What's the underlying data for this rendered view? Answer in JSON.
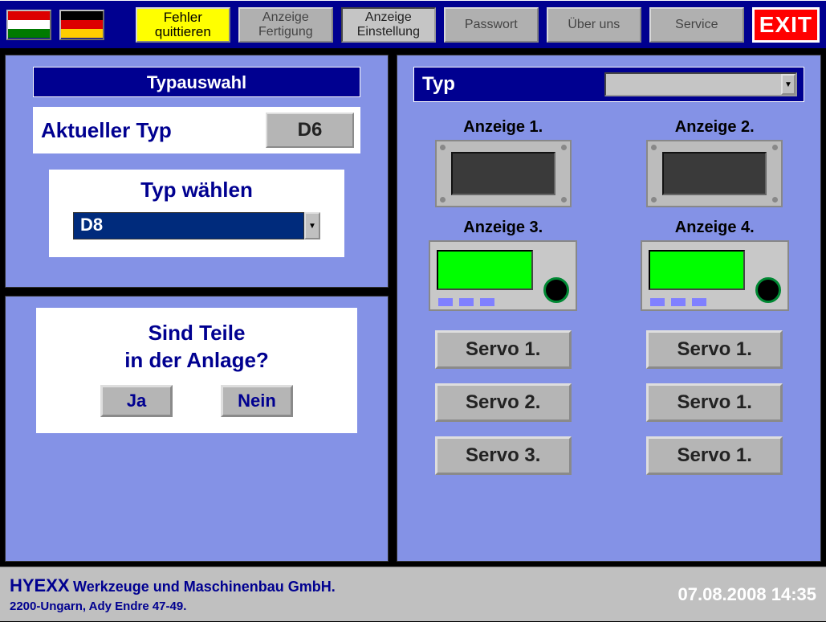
{
  "topbar": {
    "fehler_label": "Fehler\nquittieren",
    "anzeige_fertigung": "Anzeige\nFertigung",
    "anzeige_einstellung": "Anzeige\nEinstellung",
    "passwort": "Passwort",
    "ueber_uns": "Über uns",
    "service": "Service",
    "exit": "EXIT"
  },
  "left": {
    "header": "Typauswahl",
    "current_label": "Aktueller Typ",
    "current_value": "D6",
    "select_title": "Typ wählen",
    "select_value": "D8",
    "question_line1": "Sind Teile",
    "question_line2": "in der Anlage?",
    "yes": "Ja",
    "no": "Nein"
  },
  "right": {
    "typ_label": "Typ",
    "typ_value": "",
    "anzeige": [
      "Anzeige 1.",
      "Anzeige 2.",
      "Anzeige 3.",
      "Anzeige 4."
    ],
    "servos": [
      "Servo 1.",
      "Servo 1.",
      "Servo 2.",
      "Servo 1.",
      "Servo 3.",
      "Servo 1."
    ]
  },
  "footer": {
    "company": "HYEXX",
    "tagline": "Werkzeuge und Maschinenbau GmbH.",
    "address": "2200-Ungarn, Ady Endre 47-49.",
    "datetime": "07.08.2008 14:35"
  }
}
